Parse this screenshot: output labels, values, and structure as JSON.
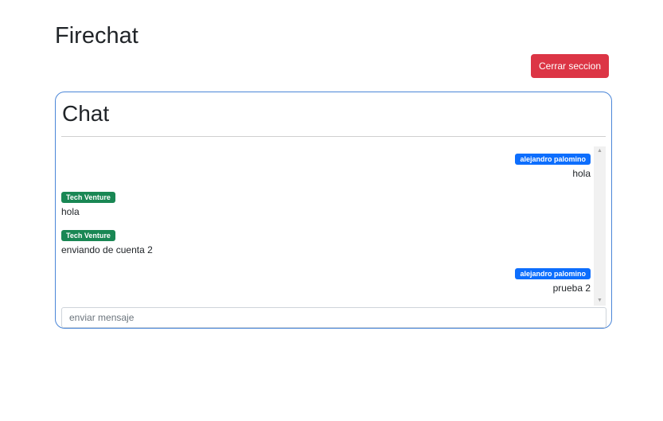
{
  "header": {
    "app_title": "Firechat",
    "logout_label": "Cerrar seccion"
  },
  "chat": {
    "heading": "Chat",
    "messages": [
      {
        "author": "alejandro palomino",
        "text": "hola",
        "side": "right",
        "badge_color": "#0d6efd"
      },
      {
        "author": "Tech Venture",
        "text": "hola",
        "side": "left",
        "badge_color": "#198754"
      },
      {
        "author": "Tech Venture",
        "text": "enviando de cuenta 2",
        "side": "left",
        "badge_color": "#198754"
      },
      {
        "author": "alejandro palomino",
        "text": "prueba 2",
        "side": "right",
        "badge_color": "#0d6efd"
      }
    ],
    "input": {
      "placeholder": "enviar mensaje",
      "value": ""
    }
  },
  "colors": {
    "danger": "#dc3545",
    "primary": "#0d6efd",
    "success": "#198754",
    "card_border": "#4b86d8"
  },
  "icons": {
    "scroll_up": "up-arrow-icon",
    "scroll_down": "down-arrow-icon"
  }
}
